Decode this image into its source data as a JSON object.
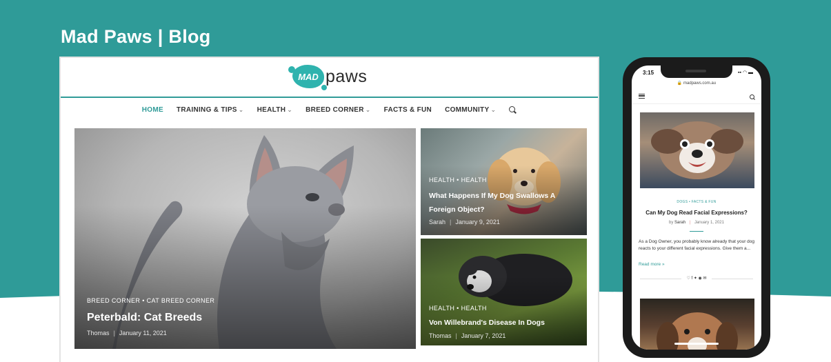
{
  "page": {
    "title": "Mad Paws | Blog"
  },
  "colors": {
    "teal": "#2f9b98",
    "logo_teal": "#2fb3ae",
    "text_dark": "#333333"
  },
  "desktop": {
    "logo": {
      "mark": "MAD",
      "word": "paws"
    },
    "nav": [
      {
        "label": "HOME",
        "active": true
      },
      {
        "label": "TRAINING & TIPS",
        "dropdown": true
      },
      {
        "label": "HEALTH",
        "dropdown": true
      },
      {
        "label": "BREED CORNER",
        "dropdown": true
      },
      {
        "label": "FACTS & FUN"
      },
      {
        "label": "COMMUNITY",
        "dropdown": true
      }
    ],
    "nav_chevron": "⌄",
    "search_icon": "search-icon",
    "featured": {
      "categories": "BREED CORNER  •  CAT BREED CORNER",
      "title": "Peterbald: Cat Breeds",
      "author": "Thomas",
      "date": "January 11, 2021"
    },
    "cards": [
      {
        "categories": "HEALTH  •  HEALTH",
        "title": "What Happens If My Dog Swallows A Foreign Object?",
        "author": "Sarah",
        "date": "January 9, 2021"
      },
      {
        "categories": "HEALTH  •  HEALTH",
        "title": "Von Willebrand's Disease In Dogs",
        "author": "Thomas",
        "date": "January 7, 2021"
      }
    ]
  },
  "phone": {
    "time": "3:15",
    "status_icons": "▪▪ ◠ ▬",
    "url": "🔒 madpaws.com.au",
    "post": {
      "categories": "DOGS  •  FACTS & FUN",
      "title": "Can My Dog Read Facial Expressions?",
      "by": "by",
      "author": "Sarah",
      "separator": "|",
      "date": "January 1, 2021",
      "excerpt": "As a Dog Owner, you probably know already that your dog reacts to your different facial expressions. Give them a...",
      "read_more": "Read more »",
      "share_icons": "♡ f ✦ ◉ ✉"
    }
  }
}
